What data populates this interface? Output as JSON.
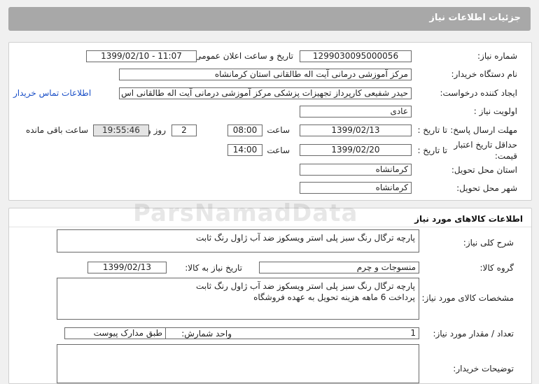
{
  "header": {
    "title": "جزئیات اطلاعات نیاز"
  },
  "need_info": {
    "need_number_label": "شماره نیاز:",
    "need_number": "1299030095000056",
    "announce_label": "تاریخ و ساعت اعلان عمومی:",
    "announce_value": "1399/02/10 - 11:07",
    "buyer_org_label": "نام دستگاه خریدار:",
    "buyer_org": "مرکز آموزشی درمانی آیت اله طالقانی استان کرمانشاه",
    "creator_label": "ایجاد کننده درخواست:",
    "creator": "حیدر شفیعی کارپرداز تجهیزات پزشکی مرکز آموزشی درمانی آیت اله طالقانی اس",
    "contact_link": "اطلاعات تماس خریدار",
    "priority_label": "اولویت نیاز :",
    "priority": "عادی",
    "deadline_label": "مهلت ارسال پاسخ:",
    "to_date_label": "تا تاریخ :",
    "deadline_date": "1399/02/13",
    "time_label": "ساعت",
    "deadline_time": "08:00",
    "days_value": "2",
    "days_label": "روز و",
    "remaining_time": "19:55:46",
    "remaining_label": "ساعت باقی مانده",
    "validity_label_1": "حداقل تاریخ اعتبار",
    "validity_label_2": "قیمت:",
    "validity_to_label": "تا تاریخ :",
    "validity_date": "1399/02/20",
    "validity_time_label": "ساعت",
    "validity_time": "14:00",
    "province_label": "استان محل تحویل:",
    "province": "کرمانشاه",
    "city_label": "شهر محل تحویل:",
    "city": "کرمانشاه"
  },
  "goods": {
    "section_title": "اطلاعات کالاهای مورد نیاز",
    "general_desc_label": "شرح کلی نیاز:",
    "general_desc": "پارچه ترگال رنگ سبز پلی استر ویسکوز ضد آب ژاول رنگ ثابت",
    "group_label": "گروه کالا:",
    "group": "منسوجات و چرم",
    "need_date_label": "تاریخ نیاز به کالا:",
    "need_date": "1399/02/13",
    "specs_label": "مشخصات کالای مورد نیاز:",
    "specs_line1": "پارچه ترگال رنگ سبز پلی استر ویسکوز ضد آب ژاول رنگ ثابت",
    "specs_line2": "پرداخت 6 ماهه هزینه تحویل به عهده فروشگاه",
    "qty_label": "تعداد / مقدار مورد نیاز:",
    "qty": "1",
    "unit_label": "واحد شمارش:",
    "unit": "طبق مدارک پیوست",
    "buyer_notes_label": "توضیحات خریدار:",
    "buyer_notes": ""
  },
  "watermark": "ParsNamadData"
}
